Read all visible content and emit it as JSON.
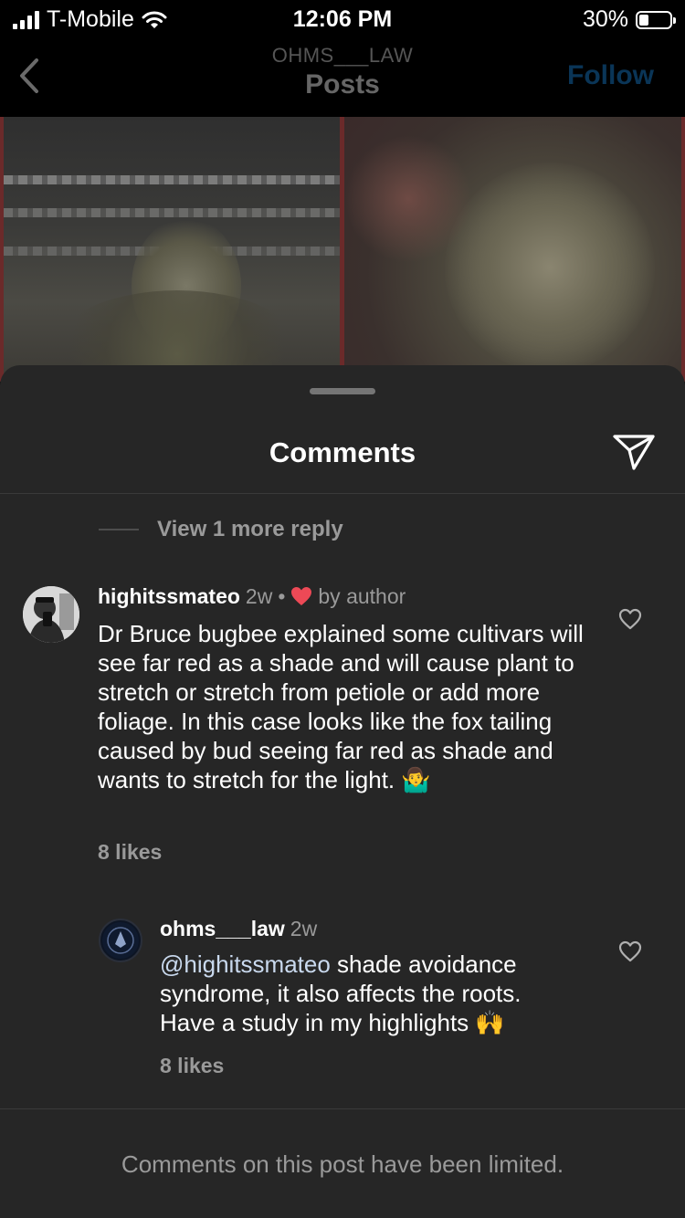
{
  "status_bar": {
    "carrier": "T-Mobile",
    "time": "12:06 PM",
    "battery_percent": "30%",
    "battery_level": 0.3,
    "icons": [
      "signal-bars-icon",
      "wifi-icon",
      "battery-icon"
    ]
  },
  "header": {
    "username": "OHMS___LAW",
    "title": "Posts",
    "follow_label": "Follow",
    "back_icon": "chevron-left-icon"
  },
  "sheet": {
    "title": "Comments",
    "send_icon": "paper-plane-icon",
    "view_more_replies": "View 1 more reply",
    "footer_note": "Comments on this post have been limited."
  },
  "comments": [
    {
      "username": "highitssmateo",
      "time": "2w",
      "separator": "•",
      "liked_by_author": "by author",
      "text": "Dr Bruce bugbee explained some cultivars will see far red as a shade and will cause plant to stretch  or stretch from petiole or add more foliage. In this case looks like the fox tailing caused by bud seeing far red as shade and wants to stretch for the light. 🤷‍♂️",
      "likes": "8 likes"
    },
    {
      "username": "ohms___law",
      "time": "2w",
      "mention": "@highitssmateo",
      "text": " shade avoidance syndrome, it also affects the roots. Have a study in my highlights 🙌",
      "likes": "8 likes"
    }
  ],
  "colors": {
    "sheet_bg": "#262626",
    "follow": "#0a3557",
    "heart": "#ed4956",
    "muted_text": "#9a9a9a"
  }
}
